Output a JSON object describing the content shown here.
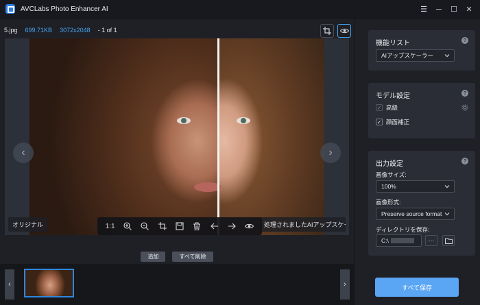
{
  "app": {
    "title": "AVCLabs Photo Enhancer AI"
  },
  "window_controls": {
    "menu": "☰",
    "minimize": "─",
    "maximize": "☐",
    "close": "✕"
  },
  "file_info": {
    "filename": "5.jpg",
    "size": "699.71KB",
    "resolution": "3072x2048",
    "position": "- 1 of 1"
  },
  "viewer": {
    "label_original": "オリジナル",
    "label_enhanced": "処理されましたAIアップスケーラー",
    "toolbar": {
      "ratio": "1:1"
    }
  },
  "actions": {
    "add": "追加",
    "delete_all": "すべて削除"
  },
  "panel": {
    "function_list": {
      "title": "機能リスト",
      "selected": "AIアップスケーラー"
    },
    "model_settings": {
      "title": "モデル設定",
      "options": [
        {
          "label": "高級",
          "checked": true,
          "dimmed": true
        },
        {
          "label": "顔面補正",
          "checked": true,
          "dimmed": false
        }
      ]
    },
    "output_settings": {
      "title": "出力設定",
      "size_label": "画像サイズ:",
      "size_value": "100%",
      "format_label": "画像形式:",
      "format_value": "Preserve source format",
      "dir_label": "ディレクトリを保存:",
      "dir_value": "C:\\"
    },
    "save_all": "すべて保存"
  },
  "colors": {
    "accent": "#2f86e0",
    "link_text": "#4aa3ee",
    "save_button": "#5aa5f4"
  }
}
